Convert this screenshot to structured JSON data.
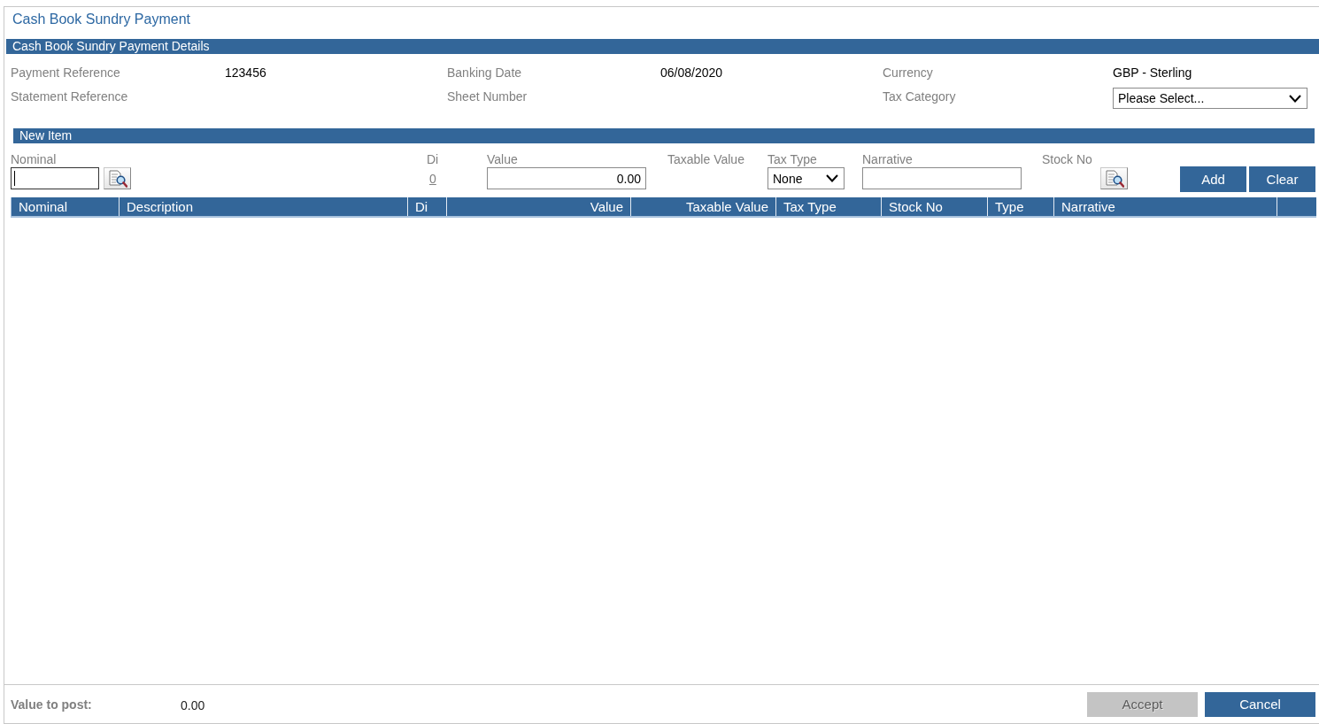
{
  "window": {
    "title": "Cash Book Sundry Payment"
  },
  "details": {
    "heading": "Cash Book Sundry Payment Details",
    "fields": [
      {
        "label": "Payment Reference",
        "kind": "text",
        "value": "123456"
      },
      {
        "label": "Banking Date",
        "kind": "text",
        "value": "06/08/2020"
      },
      {
        "label": "Currency",
        "kind": "text",
        "value": "GBP - Sterling"
      },
      {
        "label": "Statement Reference",
        "kind": "text"
      },
      {
        "label": "Sheet Number",
        "kind": "text"
      },
      {
        "label": "Tax Category",
        "kind": "select",
        "value": "Please Select..."
      }
    ]
  },
  "new_item": {
    "heading": "New Item",
    "fields": [
      {
        "label": "Nominal",
        "kind": "lookup-input",
        "focused": true
      },
      {
        "label": "Di",
        "kind": "link",
        "value": "0"
      },
      {
        "label": "Value",
        "kind": "number-input",
        "value": "0.00"
      },
      {
        "label": "Taxable Value",
        "kind": "display"
      },
      {
        "label": "Tax Type",
        "kind": "select",
        "value": "None"
      },
      {
        "label": "Narrative",
        "kind": "input"
      },
      {
        "label": "Stock No",
        "kind": "lookup"
      }
    ],
    "buttons": [
      {
        "label": "Add",
        "disabled": false
      },
      {
        "label": "Clear",
        "disabled": false
      }
    ]
  },
  "table": {
    "columns": [
      {
        "label": "Nominal",
        "kind": "text"
      },
      {
        "label": "Description",
        "kind": "text"
      },
      {
        "label": "Di",
        "kind": "text"
      },
      {
        "label": "Value",
        "kind": "numeric"
      },
      {
        "label": "Taxable Value",
        "kind": "numeric"
      },
      {
        "label": "Tax Type",
        "kind": "text"
      },
      {
        "label": "Stock No",
        "kind": "text"
      },
      {
        "label": "Type",
        "kind": "text"
      },
      {
        "label": "Narrative",
        "kind": "text"
      }
    ]
  },
  "footer": {
    "label": "Value to post:",
    "value": "0.00",
    "buttons": [
      {
        "label": "Accept",
        "disabled": true
      },
      {
        "label": "Cancel",
        "disabled": false
      }
    ]
  }
}
